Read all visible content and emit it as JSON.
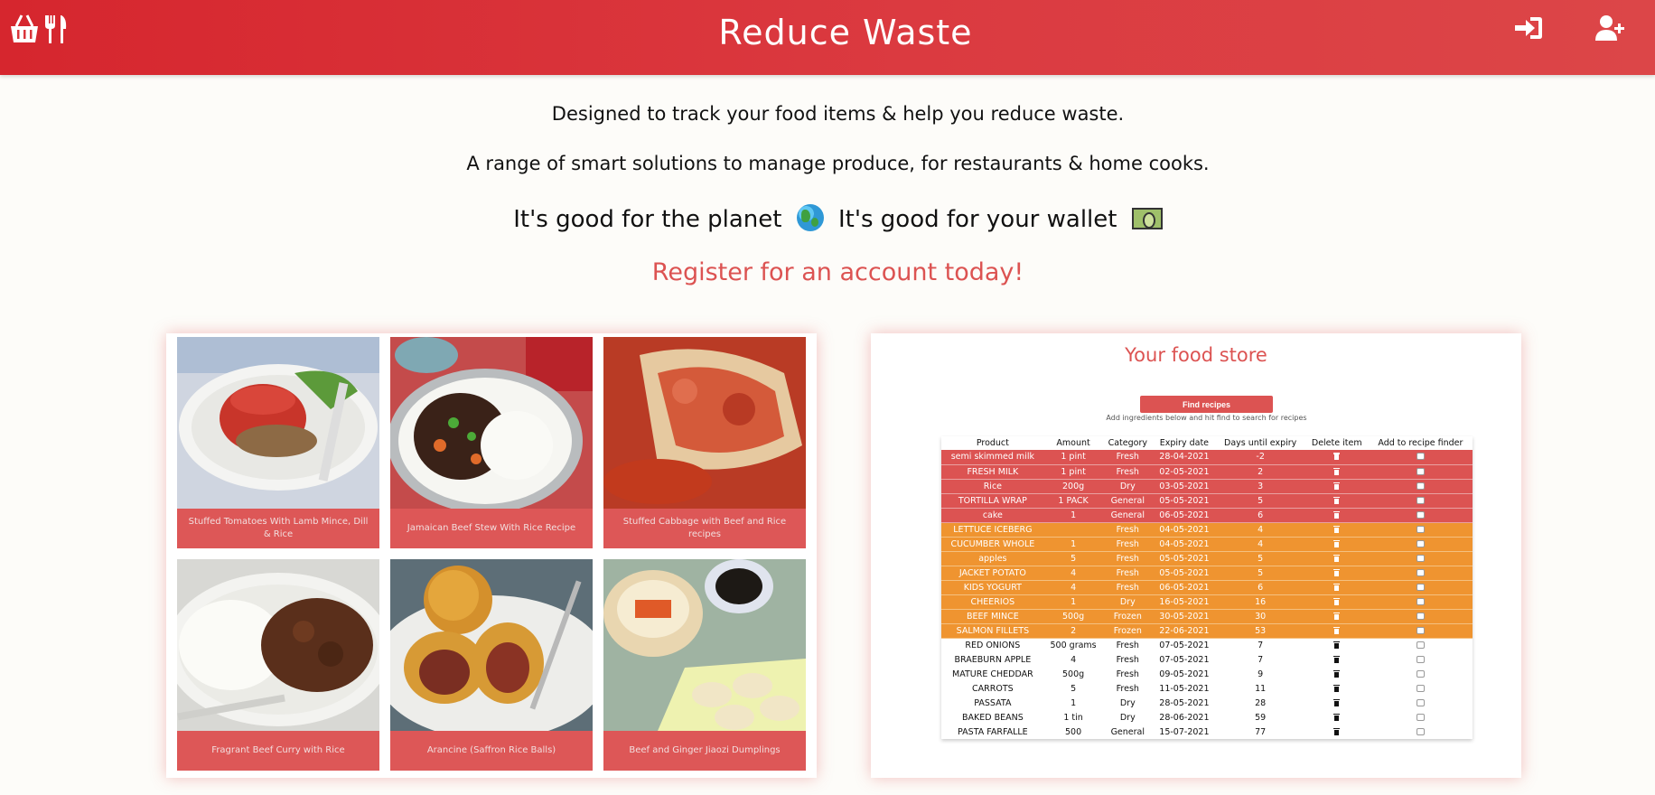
{
  "header": {
    "title": "Reduce Waste",
    "logo_icon": "basket-cutlery-icon",
    "login_icon": "sign-in-icon",
    "register_icon": "user-plus-icon",
    "color": "#d6262e"
  },
  "intro": {
    "line1": "Designed to track your food items & help you reduce waste.",
    "line2": "A range of smart solutions to manage produce, for restaurants & home cooks.",
    "line3_part1": "It's good for the planet",
    "line3_part2": "It's good for your wallet",
    "cta": "Register for an account today!"
  },
  "recipes": [
    {
      "title": "Stuffed Tomatoes With Lamb Mince, Dill & Rice"
    },
    {
      "title": "Jamaican Beef Stew With Rice Recipe"
    },
    {
      "title": "Stuffed Cabbage with Beef and Rice recipes"
    },
    {
      "title": "Fragrant Beef Curry with Rice"
    },
    {
      "title": "Arancine (Saffron Rice Balls)"
    },
    {
      "title": "Beef and Ginger Jiaozi Dumplings"
    }
  ],
  "store": {
    "title": "Your food store",
    "find_button": "Find recipes",
    "hint": "Add ingredients below and hit find to search for recipes",
    "columns": [
      "Product",
      "Amount",
      "Category",
      "Expiry date",
      "Days until expiry",
      "Delete item",
      "Add to recipe finder"
    ],
    "rows": [
      {
        "product": "semi skimmed milk",
        "amount": "1 pint",
        "category": "Fresh",
        "expiry": "28-04-2021",
        "days": "-2",
        "status": "red"
      },
      {
        "product": "FRESH MILK",
        "amount": "1 pint",
        "category": "Fresh",
        "expiry": "02-05-2021",
        "days": "2",
        "status": "red"
      },
      {
        "product": "Rice",
        "amount": "200g",
        "category": "Dry",
        "expiry": "03-05-2021",
        "days": "3",
        "status": "red"
      },
      {
        "product": "TORTILLA WRAP",
        "amount": "1 PACK",
        "category": "General",
        "expiry": "05-05-2021",
        "days": "5",
        "status": "red"
      },
      {
        "product": "cake",
        "amount": "1",
        "category": "General",
        "expiry": "06-05-2021",
        "days": "6",
        "status": "red"
      },
      {
        "product": "LETTUCE ICEBERG",
        "amount": "",
        "category": "Fresh",
        "expiry": "04-05-2021",
        "days": "4",
        "status": "orange"
      },
      {
        "product": "CUCUMBER WHOLE",
        "amount": "1",
        "category": "Fresh",
        "expiry": "04-05-2021",
        "days": "4",
        "status": "orange"
      },
      {
        "product": "apples",
        "amount": "5",
        "category": "Fresh",
        "expiry": "05-05-2021",
        "days": "5",
        "status": "orange"
      },
      {
        "product": "JACKET POTATO",
        "amount": "4",
        "category": "Fresh",
        "expiry": "05-05-2021",
        "days": "5",
        "status": "orange"
      },
      {
        "product": "KIDS YOGURT",
        "amount": "4",
        "category": "Fresh",
        "expiry": "06-05-2021",
        "days": "6",
        "status": "orange"
      },
      {
        "product": "CHEERIOS",
        "amount": "1",
        "category": "Dry",
        "expiry": "16-05-2021",
        "days": "16",
        "status": "orange"
      },
      {
        "product": "BEEF MINCE",
        "amount": "500g",
        "category": "Frozen",
        "expiry": "30-05-2021",
        "days": "30",
        "status": "orange"
      },
      {
        "product": "SALMON FILLETS",
        "amount": "2",
        "category": "Frozen",
        "expiry": "22-06-2021",
        "days": "53",
        "status": "orange"
      },
      {
        "product": "RED ONIONS",
        "amount": "500 grams",
        "category": "Fresh",
        "expiry": "07-05-2021",
        "days": "7",
        "status": "white"
      },
      {
        "product": "BRAEBURN APPLE",
        "amount": "4",
        "category": "Fresh",
        "expiry": "07-05-2021",
        "days": "7",
        "status": "white"
      },
      {
        "product": "MATURE CHEDDAR",
        "amount": "500g",
        "category": "Fresh",
        "expiry": "09-05-2021",
        "days": "9",
        "status": "white"
      },
      {
        "product": "CARROTS",
        "amount": "5",
        "category": "Fresh",
        "expiry": "11-05-2021",
        "days": "11",
        "status": "white"
      },
      {
        "product": "PASSATA",
        "amount": "1",
        "category": "Dry",
        "expiry": "28-05-2021",
        "days": "28",
        "status": "white"
      },
      {
        "product": "BAKED BEANS",
        "amount": "1 tin",
        "category": "Dry",
        "expiry": "28-06-2021",
        "days": "59",
        "status": "white"
      },
      {
        "product": "PASTA FARFALLE",
        "amount": "500",
        "category": "General",
        "expiry": "15-07-2021",
        "days": "77",
        "status": "white"
      }
    ]
  }
}
